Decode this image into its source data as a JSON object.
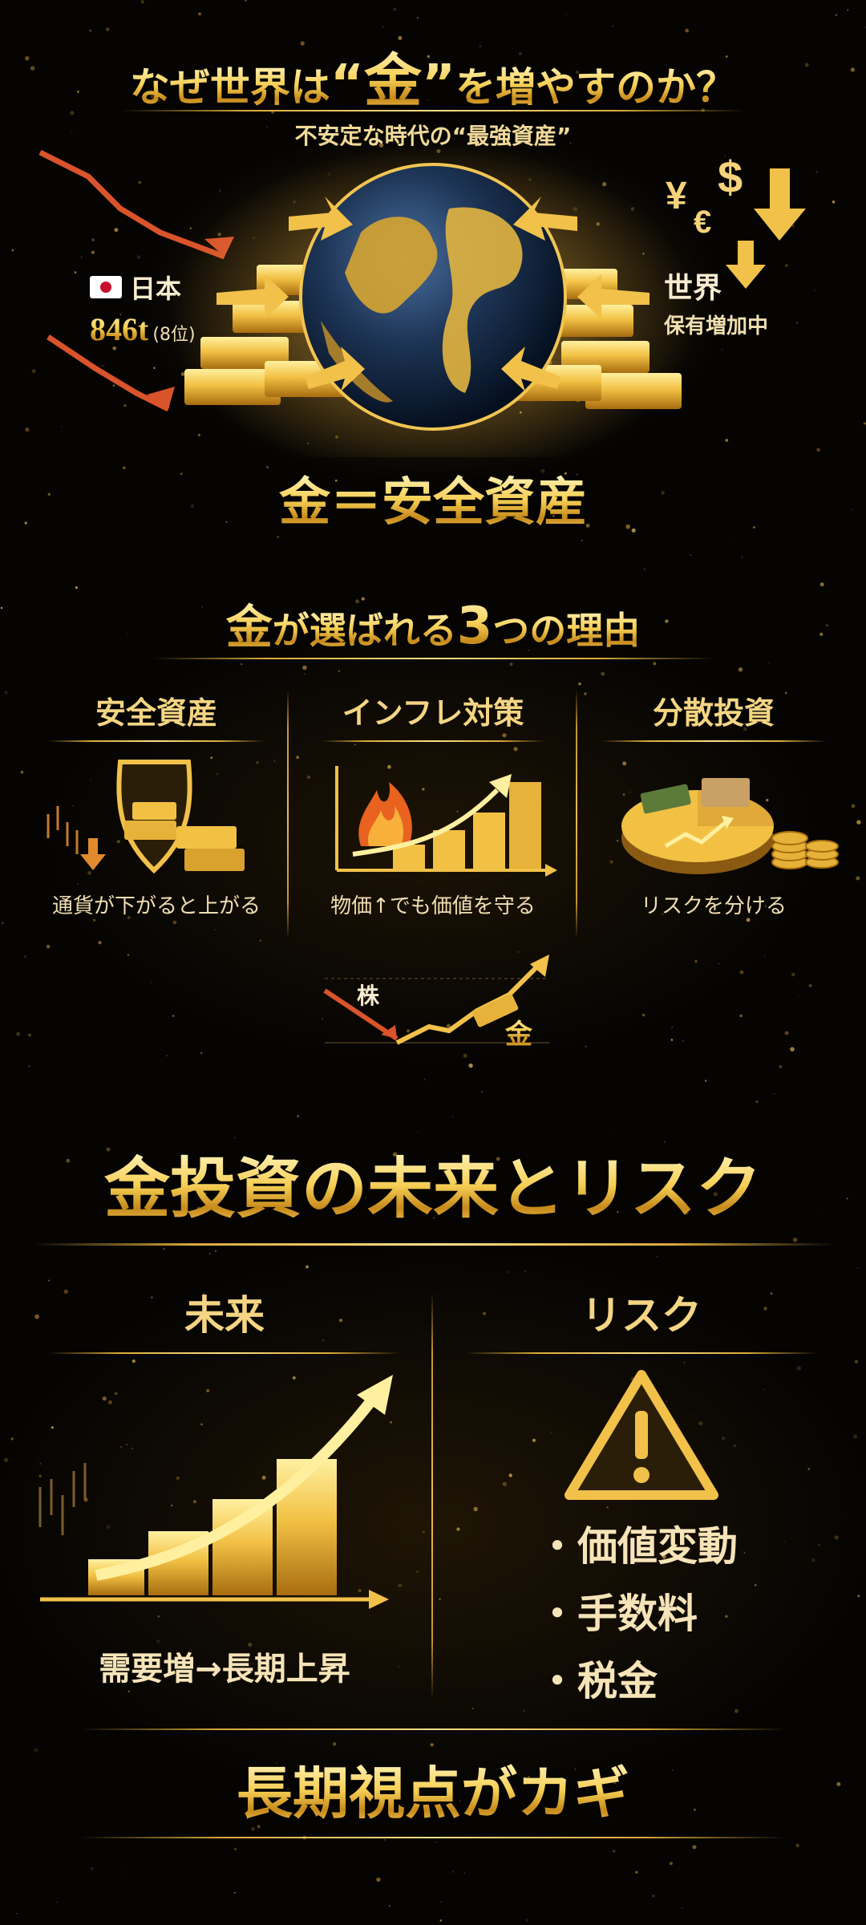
{
  "header": {
    "title_prefix": "なぜ世界は",
    "title_quote_open": "“",
    "title_highlight": "金",
    "title_quote_close": "”",
    "title_suffix": "を増やすのか？",
    "subtitle": "不安定な時代の“最強資産”"
  },
  "hero": {
    "japan_label": "日本",
    "japan_amount": "846t",
    "japan_rank": "(8位)",
    "world_label": "世界",
    "world_status": "保有増加中",
    "currency_symbols": "¥ $ €",
    "conclusion": "金＝安全資産"
  },
  "reasons": {
    "heading_gold": "金",
    "heading_mid": "が選ばれる",
    "heading_num": "3",
    "heading_end": "つの理由",
    "items": [
      {
        "title": "安全資産",
        "caption": "通貨が下がると上がる",
        "icon": "shield-gold-icon"
      },
      {
        "title": "インフレ対策",
        "caption": "物価↑でも価値を守る",
        "icon": "fire-bar-chart-icon"
      },
      {
        "title": "分散投資",
        "caption": "リスクを分ける",
        "icon": "pie-chart-coins-icon"
      }
    ],
    "compare": {
      "stock_label": "株",
      "gold_label": "金"
    }
  },
  "future_risk": {
    "heading": "金投資の未来とリスク",
    "future": {
      "title": "未来",
      "caption": "需要増→長期上昇"
    },
    "risk": {
      "title": "リスク",
      "items": [
        "・価値変動",
        "・手数料",
        "・税金"
      ]
    }
  },
  "footer": {
    "tagline": "長期視点がカギ"
  },
  "colors": {
    "gold": "#f6cf55",
    "dark_gold": "#c68a1b",
    "background": "#050403",
    "red_arrow": "#d9532b"
  }
}
